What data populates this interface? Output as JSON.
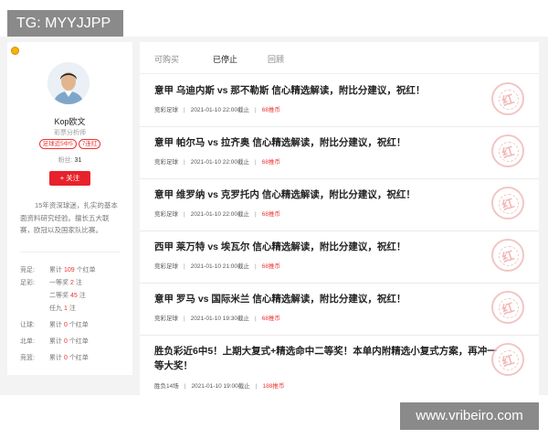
{
  "watermarks": {
    "top": "TG: MYYJJPP",
    "bottom": "www.vribeiro.com"
  },
  "profile": {
    "name": "Kop欧文",
    "role": "彩票分析师",
    "tags": [
      "足球近5中5",
      "7连红"
    ],
    "fans_label": "粉丝:",
    "fans_count": "31",
    "follow_label": "+ 关注",
    "intro": "15年资深球迷，扎实的基本面资料研究经验。擅长五大联赛，欧冠以及国家队比赛。",
    "stats": [
      {
        "key": "竞足:",
        "prefix": "累计",
        "value": "109",
        "suffix": "个红单"
      },
      {
        "key": "足彩:",
        "prefix": "一等奖",
        "value": "2",
        "suffix": "注"
      },
      {
        "key": "",
        "prefix": "二等奖",
        "value": "45",
        "suffix": "注"
      },
      {
        "key": "",
        "prefix": "任九",
        "value": "1",
        "suffix": "注"
      },
      {
        "key": "让球:",
        "prefix": "累计",
        "value": "0",
        "suffix": "个红单"
      },
      {
        "key": "北单:",
        "prefix": "累计",
        "value": "0",
        "suffix": "个红单"
      },
      {
        "key": "竞篮:",
        "prefix": "累计",
        "value": "0",
        "suffix": "个红单"
      }
    ]
  },
  "tabs": [
    "可购买",
    "已停止",
    "回顾"
  ],
  "active_tab": "已停止",
  "stamp_char": "红",
  "articles": [
    {
      "title": "意甲 乌迪内斯 vs 那不勒斯 信心精选解读，附比分建议，祝红！",
      "category": "竞彩足球",
      "time": "2021-01-10 22:00截止",
      "price": "68推币"
    },
    {
      "title": "意甲 帕尔马 vs 拉齐奥 信心精选解读，附比分建议，祝红！",
      "category": "竞彩足球",
      "time": "2021-01-10 22:00截止",
      "price": "68推币"
    },
    {
      "title": "意甲 维罗纳 vs 克罗托内 信心精选解读，附比分建议，祝红！",
      "category": "竞彩足球",
      "time": "2021-01-10 22:00截止",
      "price": "68推币"
    },
    {
      "title": "西甲 莱万特 vs 埃瓦尔 信心精选解读，附比分建议，祝红！",
      "category": "竞彩足球",
      "time": "2021-01-10 21:00截止",
      "price": "68推币"
    },
    {
      "title": "意甲 罗马 vs 国际米兰 信心精选解读，附比分建议，祝红！",
      "category": "竞彩足球",
      "time": "2021-01-10 19:30截止",
      "price": "68推币"
    },
    {
      "title": "胜负彩近6中5！上期大复式+精选命中二等奖！本单内附精选小复式方案，再冲一等大奖！",
      "category": "胜负14场",
      "time": "2021-01-10 19:00截止",
      "price": "188推币"
    }
  ]
}
